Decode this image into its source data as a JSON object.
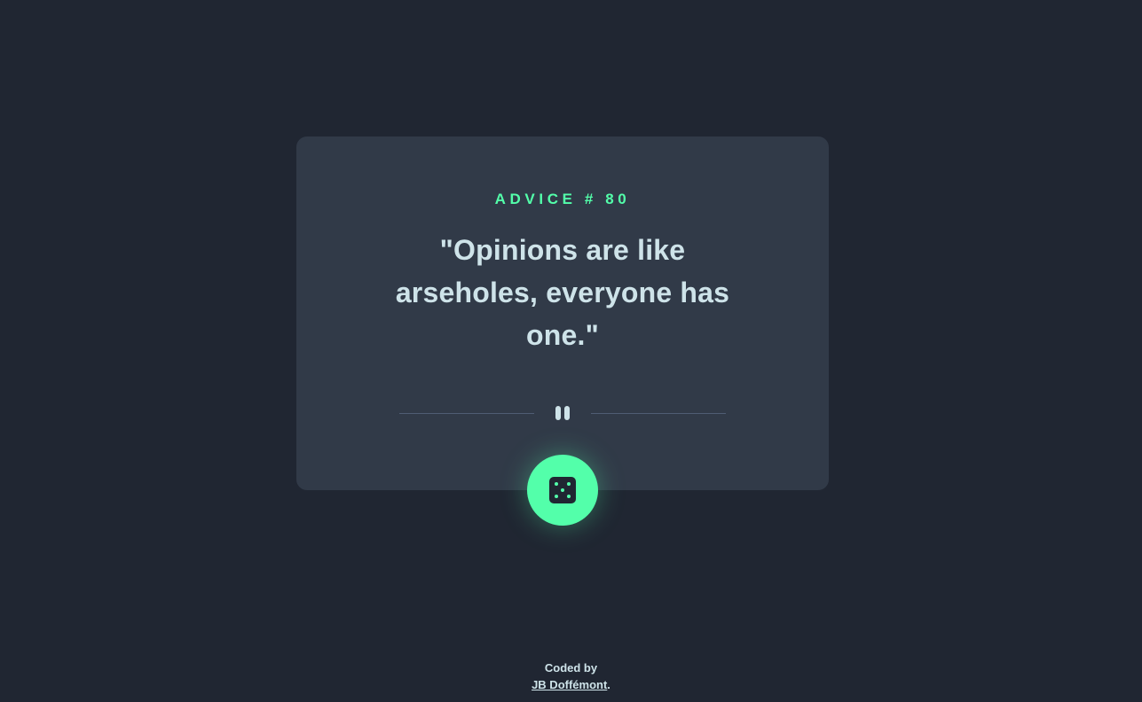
{
  "card": {
    "advice_id": "ADVICE # 80",
    "quote": "\"Opinions are like arseholes, everyone has one.\""
  },
  "divider": {
    "icon": "pause-icon"
  },
  "generate_button": {
    "icon": "dice-icon"
  },
  "footer": {
    "coded_by": "Coded by",
    "author": "JB Doffémont",
    "suffix": "."
  },
  "colors": {
    "background": "#202632",
    "card": "#313a48",
    "accent": "#53ffaa",
    "text": "#cee3e9",
    "divider": "#4f5d74"
  }
}
